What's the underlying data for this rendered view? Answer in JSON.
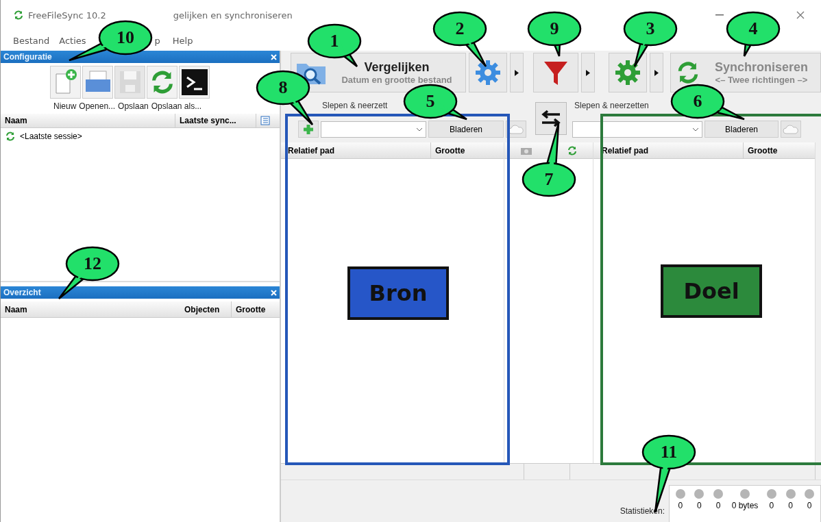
{
  "window": {
    "title_parts": [
      "FreeFileSync 10.2",
      "gelijken en synchroniseren"
    ]
  },
  "menu": [
    "Bestand",
    "Acties",
    "p",
    "Help"
  ],
  "config_panel": {
    "title": "Configuratie",
    "tools": [
      "Nieuw",
      "Openen...",
      "Opslaan",
      "Opslaan als..."
    ],
    "columns": [
      "Naam",
      "Laatste sync..."
    ],
    "rows": [
      "<Laatste sessie>"
    ]
  },
  "overview_panel": {
    "title": "Overzicht",
    "columns": [
      "Naam",
      "Objecten",
      "Grootte"
    ]
  },
  "toolbar": {
    "compare": {
      "label": "Vergelijken",
      "sub": "Datum en grootte bestand"
    },
    "sync": {
      "label": "Synchroniseren",
      "sub": "<– Twee richtingen –>"
    }
  },
  "left_folder": {
    "label": "Slepen & neerzett",
    "browse": "Bladeren"
  },
  "right_folder": {
    "label": "Slepen & neerzetten",
    "browse": "Bladeren"
  },
  "left_grid": {
    "columns": [
      "Relatief pad",
      "Grootte"
    ]
  },
  "right_grid": {
    "columns": [
      "Relatief pad",
      "Grootte"
    ]
  },
  "annotations": {
    "source": "Bron",
    "target": "Doel"
  },
  "statistics": {
    "label": "Statistieken:",
    "values": [
      "0",
      "0",
      "0",
      "0 bytes",
      "0",
      "0",
      "0"
    ]
  },
  "callouts": [
    "1",
    "2",
    "9",
    "3",
    "4",
    "10",
    "8",
    "5",
    "6",
    "7",
    "12",
    "11"
  ]
}
